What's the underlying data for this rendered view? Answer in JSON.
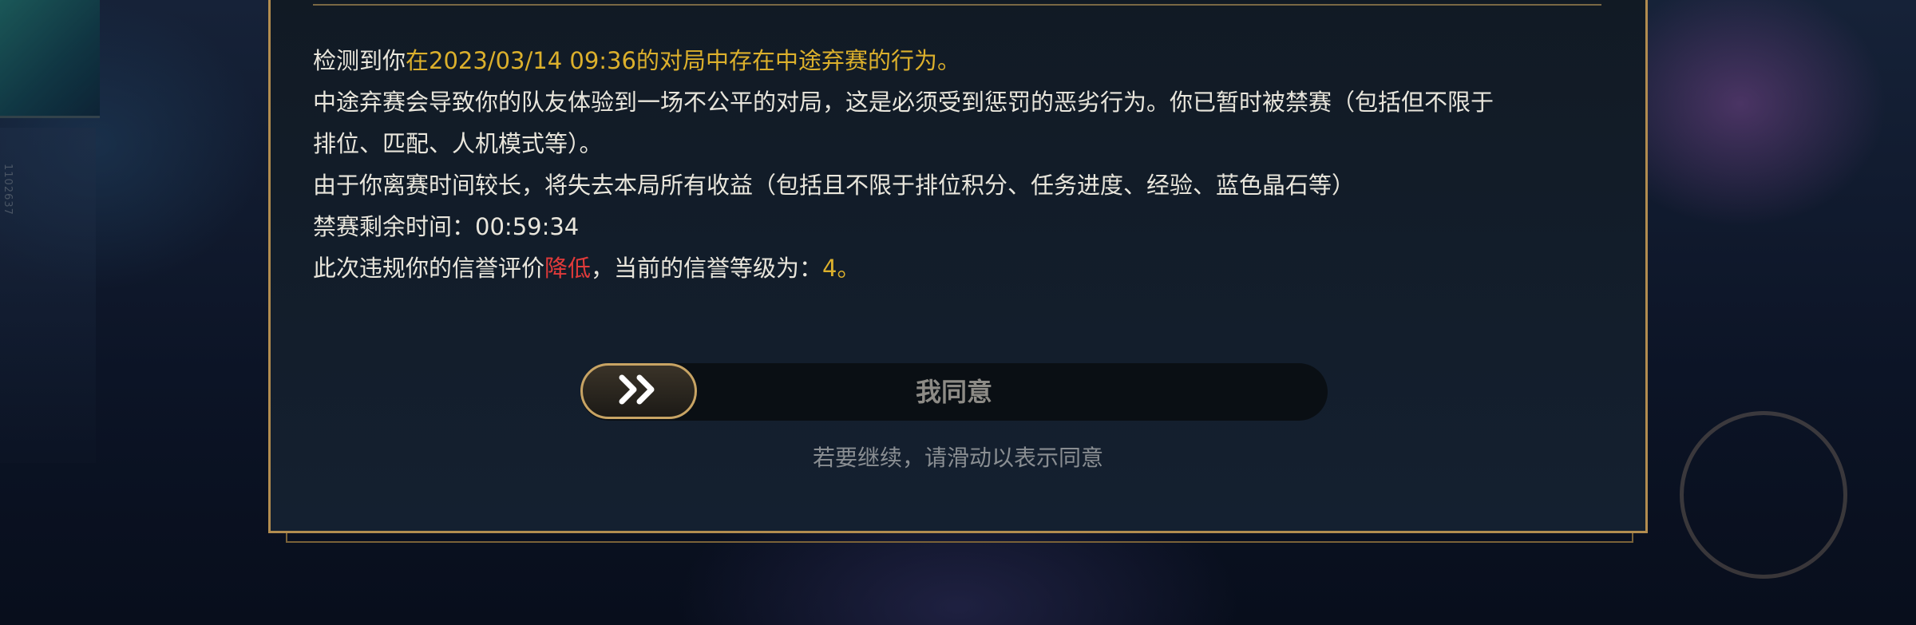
{
  "background": {
    "side_id_text": "1102637"
  },
  "message": {
    "line1_prefix": "检测到你",
    "line1_highlight": "在2023/03/14 09:36的对局中存在中途弃赛的行为。",
    "line2": "中途弃赛会导致你的队友体验到一场不公平的对局，这是必须受到惩罚的恶劣行为。你已暂时被禁赛（包括但不限于",
    "line3": "排位、匹配、人机模式等）。",
    "line4": "由于你离赛时间较长，将失去本局所有收益（包括且不限于排位积分、任务进度、经验、蓝色晶石等）",
    "line5_label": "禁赛剩余时间：",
    "line5_value": "00:59:34",
    "line6_prefix": "此次违规你的信誉评价",
    "line6_red": "降低",
    "line6_middle": "，当前的信誉等级为：",
    "line6_level": "4",
    "line6_suffix": "。"
  },
  "slider": {
    "label": "我同意",
    "handle_icon": "double-chevron-right-icon"
  },
  "hint": "若要继续，请滑动以表示同意",
  "colors": {
    "gold_accent": "#dcb02c",
    "warning_red": "#e03a3a",
    "frame_gold": "#b28c4f"
  }
}
